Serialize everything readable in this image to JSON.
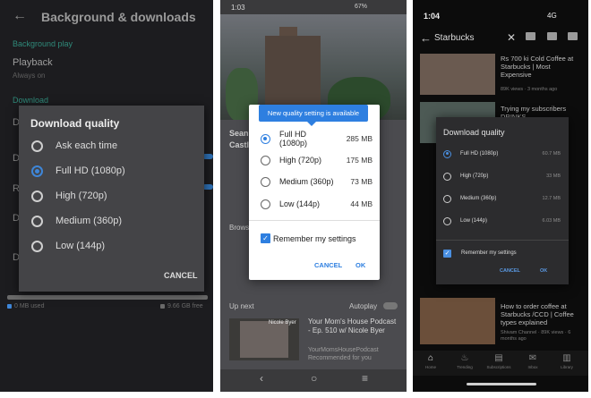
{
  "panel1": {
    "title": "Background & downloads",
    "background_label": "Background play",
    "playback_label": "Playback",
    "playback_sub": "Always on",
    "downloads_label": "Download",
    "storage": {
      "used": "0 MB used",
      "free": "9.66 GB free"
    },
    "dialog": {
      "title": "Download quality",
      "options": [
        "Ask each time",
        "Full HD (1080p)",
        "High (720p)",
        "Medium (360p)",
        "Low (144p)"
      ],
      "selected_index": 1,
      "cancel": "CANCEL"
    }
  },
  "panel2": {
    "status_time": "1:03",
    "status_battery": "67%",
    "tooltip": "New quality setting is available",
    "options": [
      {
        "label": "Full HD (1080p)",
        "size": "285 MB"
      },
      {
        "label": "High (720p)",
        "size": "175 MB"
      },
      {
        "label": "Medium (360p)",
        "size": "73 MB"
      },
      {
        "label": "Low (144p)",
        "size": "44 MB"
      }
    ],
    "selected_index": 0,
    "remember": "Remember my settings",
    "cancel": "CANCEL",
    "ok": "OK",
    "up_next": "Up next",
    "autoplay": "Autoplay",
    "rec_title": "Your Mom's House Podcast - Ep. 510 w/ Nicole Byer",
    "rec_channel": "YourMomsHousePodcast",
    "rec_meta": "Recommended for you",
    "thumb_caption": "Nicole Byer"
  },
  "panel3": {
    "status_time": "1:04",
    "status_net": "4G",
    "search_query": "Starbucks",
    "results": [
      {
        "title": "Rs 700 ki Cold Coffee at Starbucks | Most Expensive",
        "meta": "89K views · 3 months ago"
      },
      {
        "title": "Trying my subscribers DRINKS",
        "meta": ""
      },
      {
        "title": "How to order coffee at Starbucks /CCD | Coffee types explained",
        "meta": "Shivam Channel · 89K views · 6 months ago"
      }
    ],
    "dialog": {
      "title": "Download quality",
      "options": [
        {
          "label": "Full HD (1080p)",
          "size": "60.7 MB"
        },
        {
          "label": "High (720p)",
          "size": "33 MB"
        },
        {
          "label": "Medium (360p)",
          "size": "12.7 MB"
        },
        {
          "label": "Low (144p)",
          "size": "6.03 MB"
        }
      ],
      "selected_index": 0,
      "remember": "Remember my settings",
      "cancel": "CANCEL",
      "ok": "OK"
    },
    "tabs": [
      "Home",
      "Trending",
      "Subscriptions",
      "Inbox",
      "Library"
    ]
  },
  "colors": {
    "accent_blue": "#2e7fe0",
    "dark_dialog": "#444447",
    "teal_section": "#2f8a7a"
  }
}
